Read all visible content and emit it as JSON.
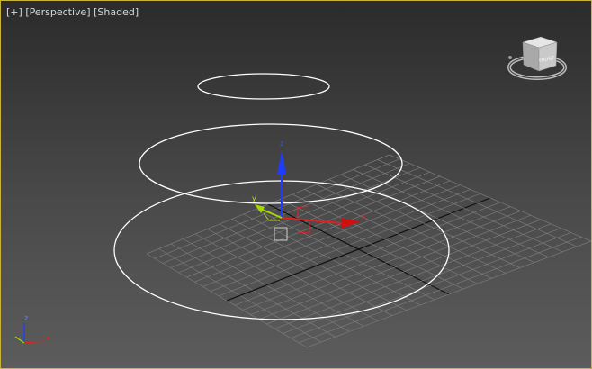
{
  "viewport": {
    "menu_plus": "[+]",
    "view_mode": "[Perspective]",
    "shading_mode": "[Shaded]"
  },
  "viewcube": {
    "face_label": "FRONT"
  },
  "gizmo": {
    "x_label": "x",
    "y_label": "y",
    "z_label": "z"
  },
  "axis_tripod": {
    "x_label": "x",
    "z_label": "z"
  },
  "colors": {
    "border_active": "#c9b437",
    "grid": "#7a7a7a",
    "grid_axis": "#111111",
    "x_axis": "#e02020",
    "y_axis": "#a4d800",
    "z_axis": "#1e3cff",
    "shapes": "#ffffff"
  }
}
